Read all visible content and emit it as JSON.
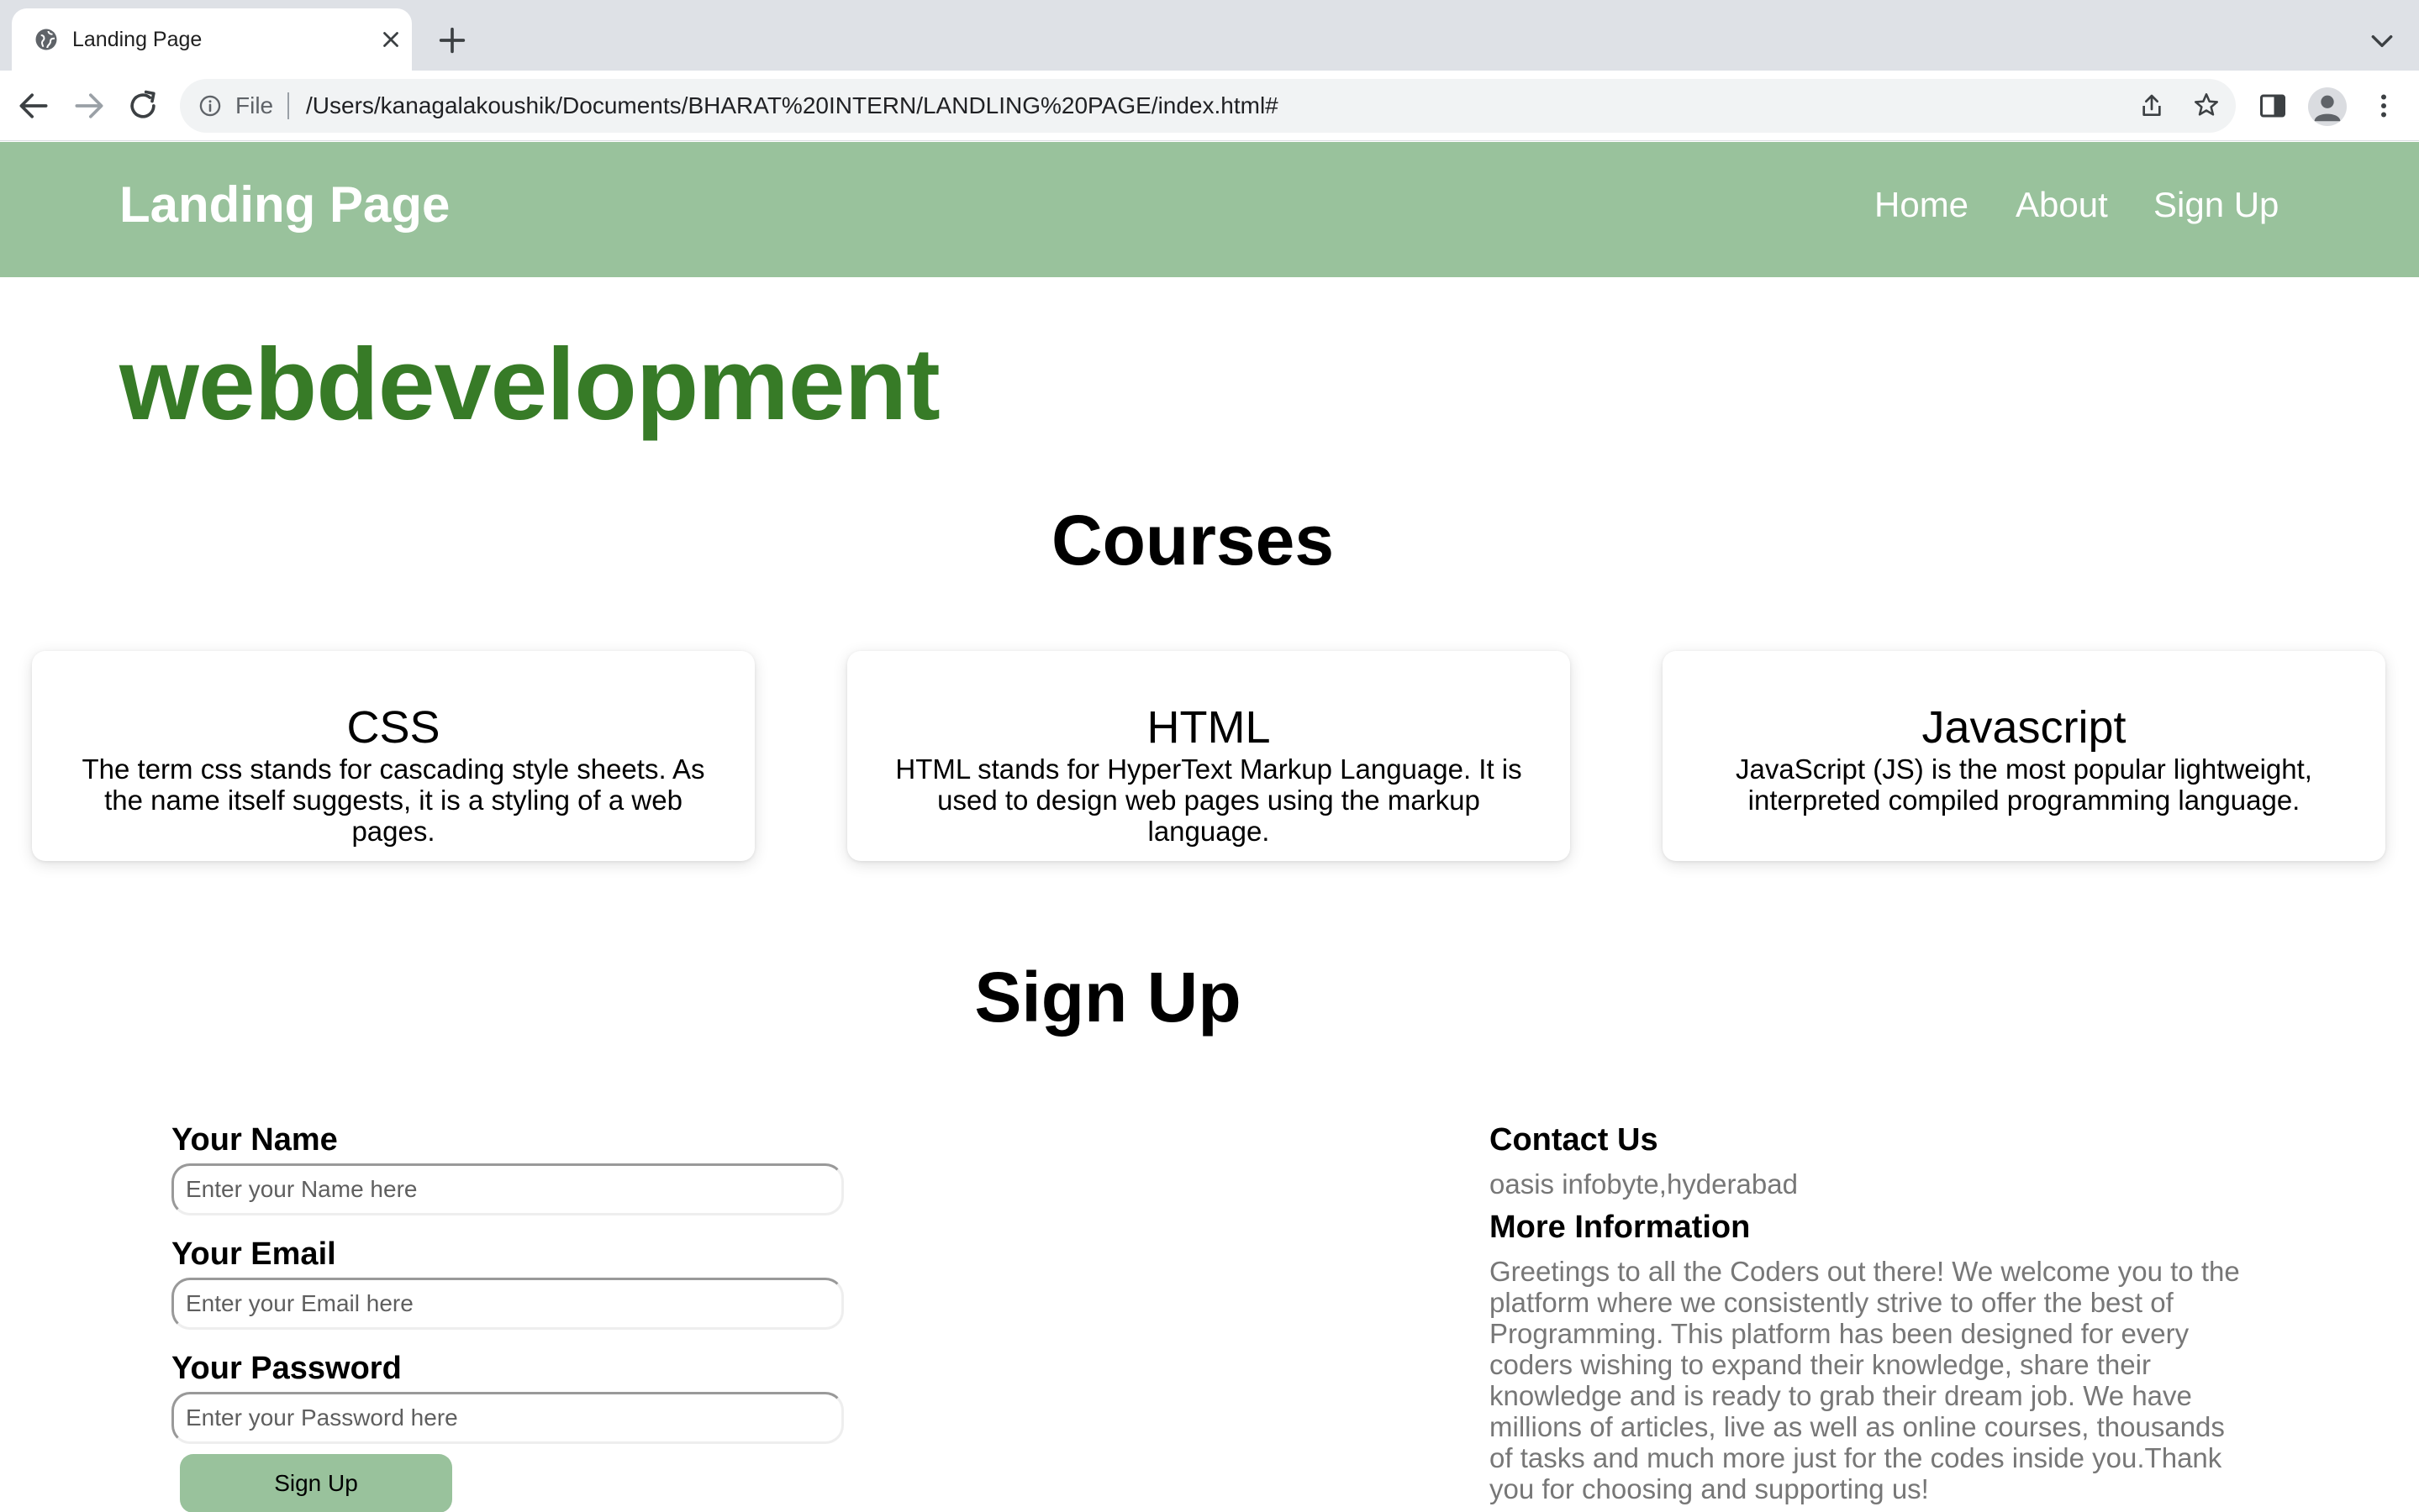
{
  "browser": {
    "tab_title": "Landing Page",
    "omnibox_scheme": "File",
    "url": "/Users/kanagalakoushik/Documents/BHARAT%20INTERN/LANDLING%20PAGE/index.html#"
  },
  "navbar": {
    "brand": "Landing Page",
    "links": [
      "Home",
      "About",
      "Sign Up"
    ],
    "color": "#99c29c"
  },
  "hero": {
    "title": "webdevelopment",
    "color": "#377b27"
  },
  "courses": {
    "heading": "Courses",
    "items": [
      {
        "title": "CSS",
        "desc": "The term css stands for cascading style sheets. As the name itself suggests, it is a styling of a web pages."
      },
      {
        "title": "HTML",
        "desc": "HTML stands for HyperText Markup Language. It is used to design web pages using the markup language."
      },
      {
        "title": "Javascript",
        "desc": "JavaScript (JS) is the most popular lightweight, interpreted compiled programming language."
      }
    ]
  },
  "signup": {
    "heading": "Sign Up",
    "name_label": "Your Name",
    "name_placeholder": "Enter your Name here",
    "email_label": "Your Email",
    "email_placeholder": "Enter your Email here",
    "password_label": "Your Password",
    "password_placeholder": "Enter your Password here",
    "button": "Sign Up"
  },
  "contact": {
    "heading": "Contact Us",
    "address": "oasis infobyte,hyderabad",
    "more_heading": "More Information",
    "more_text": "Greetings to all the Coders out there! We welcome you to the platform where we consistently strive to offer the best of Programming. This platform has been designed for every coders wishing to expand their knowledge, share their knowledge and is ready to grab their dream job. We have millions of articles, live as well as online courses, thousands of tasks and much more just for the codes inside you.Thank you for choosing and supporting us!"
  }
}
